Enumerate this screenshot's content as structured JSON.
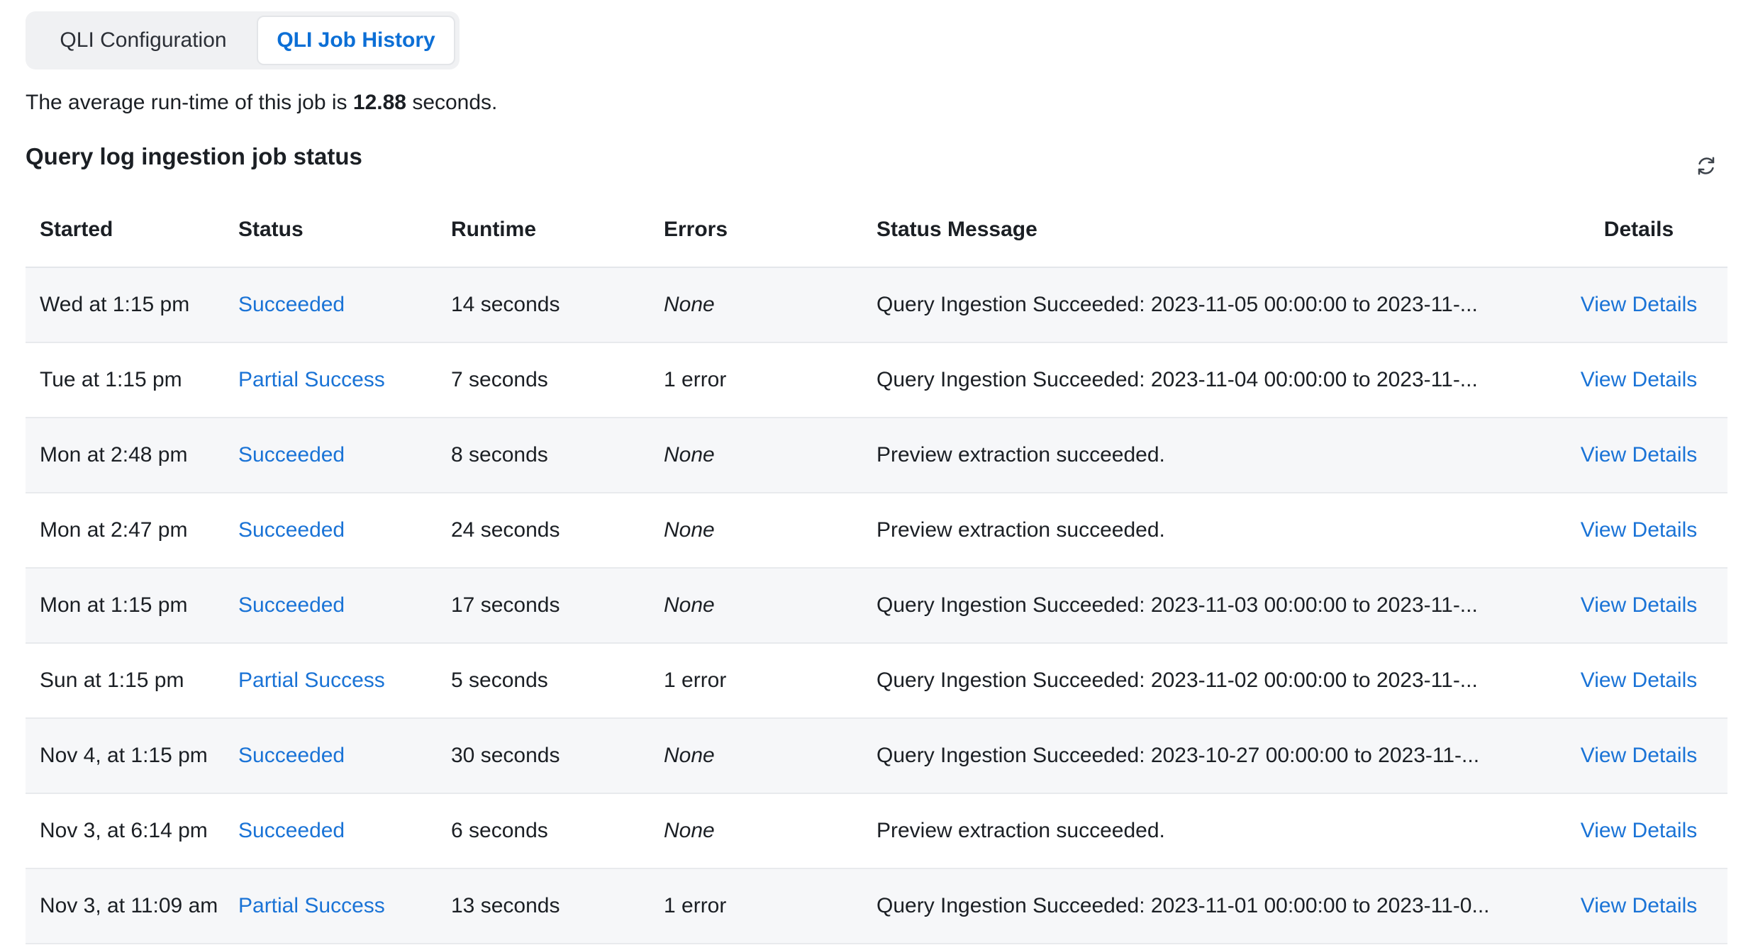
{
  "tabs": [
    {
      "label": "QLI Configuration",
      "active": false
    },
    {
      "label": "QLI Job History",
      "active": true
    }
  ],
  "average": {
    "prefix": "The average run-time of this job is",
    "value": "12.88",
    "suffix": "seconds."
  },
  "section_title": "Query log ingestion job status",
  "refresh_icon": "refresh-icon",
  "table": {
    "headers": {
      "started": "Started",
      "status": "Status",
      "runtime": "Runtime",
      "errors": "Errors",
      "message": "Status Message",
      "details": "Details"
    },
    "rows": [
      {
        "started": "Wed at 1:15 pm",
        "status": "Succeeded",
        "runtime": "14 seconds",
        "errors": "None",
        "message": "Query Ingestion Succeeded: 2023-11-05 00:00:00 to 2023-11-...",
        "details": "View Details"
      },
      {
        "started": "Tue at 1:15 pm",
        "status": "Partial Success",
        "runtime": "7 seconds",
        "errors": "1 error",
        "message": "Query Ingestion Succeeded: 2023-11-04 00:00:00 to 2023-11-...",
        "details": "View Details"
      },
      {
        "started": "Mon at 2:48 pm",
        "status": "Succeeded",
        "runtime": "8 seconds",
        "errors": "None",
        "message": "Preview extraction succeeded.",
        "details": "View Details"
      },
      {
        "started": "Mon at 2:47 pm",
        "status": "Succeeded",
        "runtime": "24 seconds",
        "errors": "None",
        "message": "Preview extraction succeeded.",
        "details": "View Details"
      },
      {
        "started": "Mon at 1:15 pm",
        "status": "Succeeded",
        "runtime": "17 seconds",
        "errors": "None",
        "message": "Query Ingestion Succeeded: 2023-11-03 00:00:00 to 2023-11-...",
        "details": "View Details"
      },
      {
        "started": "Sun at 1:15 pm",
        "status": "Partial Success",
        "runtime": "5 seconds",
        "errors": "1 error",
        "message": "Query Ingestion Succeeded: 2023-11-02 00:00:00 to 2023-11-...",
        "details": "View Details"
      },
      {
        "started": "Nov 4, at 1:15 pm",
        "status": "Succeeded",
        "runtime": "30 seconds",
        "errors": "None",
        "message": "Query Ingestion Succeeded: 2023-10-27 00:00:00 to 2023-11-...",
        "details": "View Details"
      },
      {
        "started": "Nov 3, at 6:14 pm",
        "status": "Succeeded",
        "runtime": "6 seconds",
        "errors": "None",
        "message": "Preview extraction succeeded.",
        "details": "View Details"
      },
      {
        "started": "Nov 3, at 11:09 am",
        "status": "Partial Success",
        "runtime": "13 seconds",
        "errors": "1 error",
        "message": "Query Ingestion Succeeded: 2023-11-01 00:00:00 to 2023-11-0...",
        "details": "View Details"
      }
    ]
  },
  "colors": {
    "accent": "#1a73d6",
    "active_tab_text": "#0c6fd6",
    "row_alt": "#f6f7f9"
  }
}
